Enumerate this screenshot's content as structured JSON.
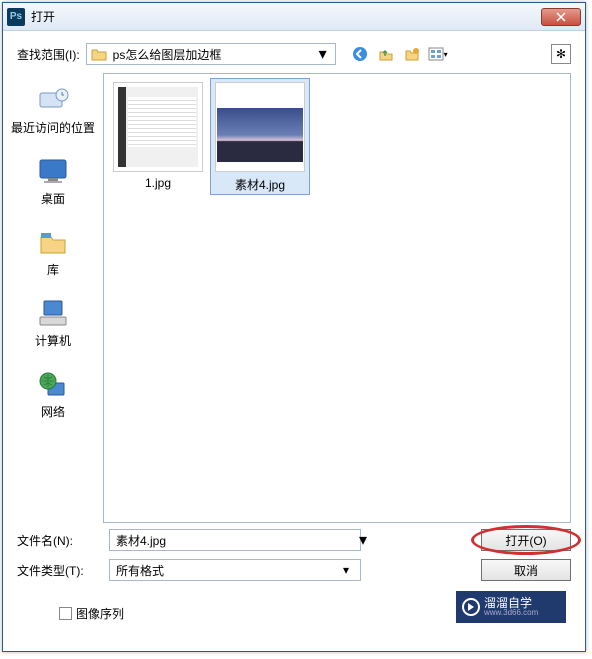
{
  "titlebar": {
    "app_mark": "Ps",
    "title": "打开"
  },
  "toolbar": {
    "look_in_label": "查找范围(I):",
    "look_in_value": "ps怎么给图层加边框"
  },
  "sidebar": {
    "items": [
      {
        "label": "最近访问的位置"
      },
      {
        "label": "桌面"
      },
      {
        "label": "库"
      },
      {
        "label": "计算机"
      },
      {
        "label": "网络"
      }
    ]
  },
  "files": {
    "items": [
      {
        "name": "1.jpg",
        "selected": false
      },
      {
        "name": "素材4.jpg",
        "selected": true
      }
    ]
  },
  "form": {
    "filename_label": "文件名(N):",
    "filename_value": "素材4.jpg",
    "filetype_label": "文件类型(T):",
    "filetype_value": "所有格式",
    "open_button": "打开(O)",
    "cancel_button": "取消",
    "image_sequence": "图像序列"
  },
  "watermark": {
    "brand": "溜溜自学",
    "url": "www.3d66.com"
  }
}
